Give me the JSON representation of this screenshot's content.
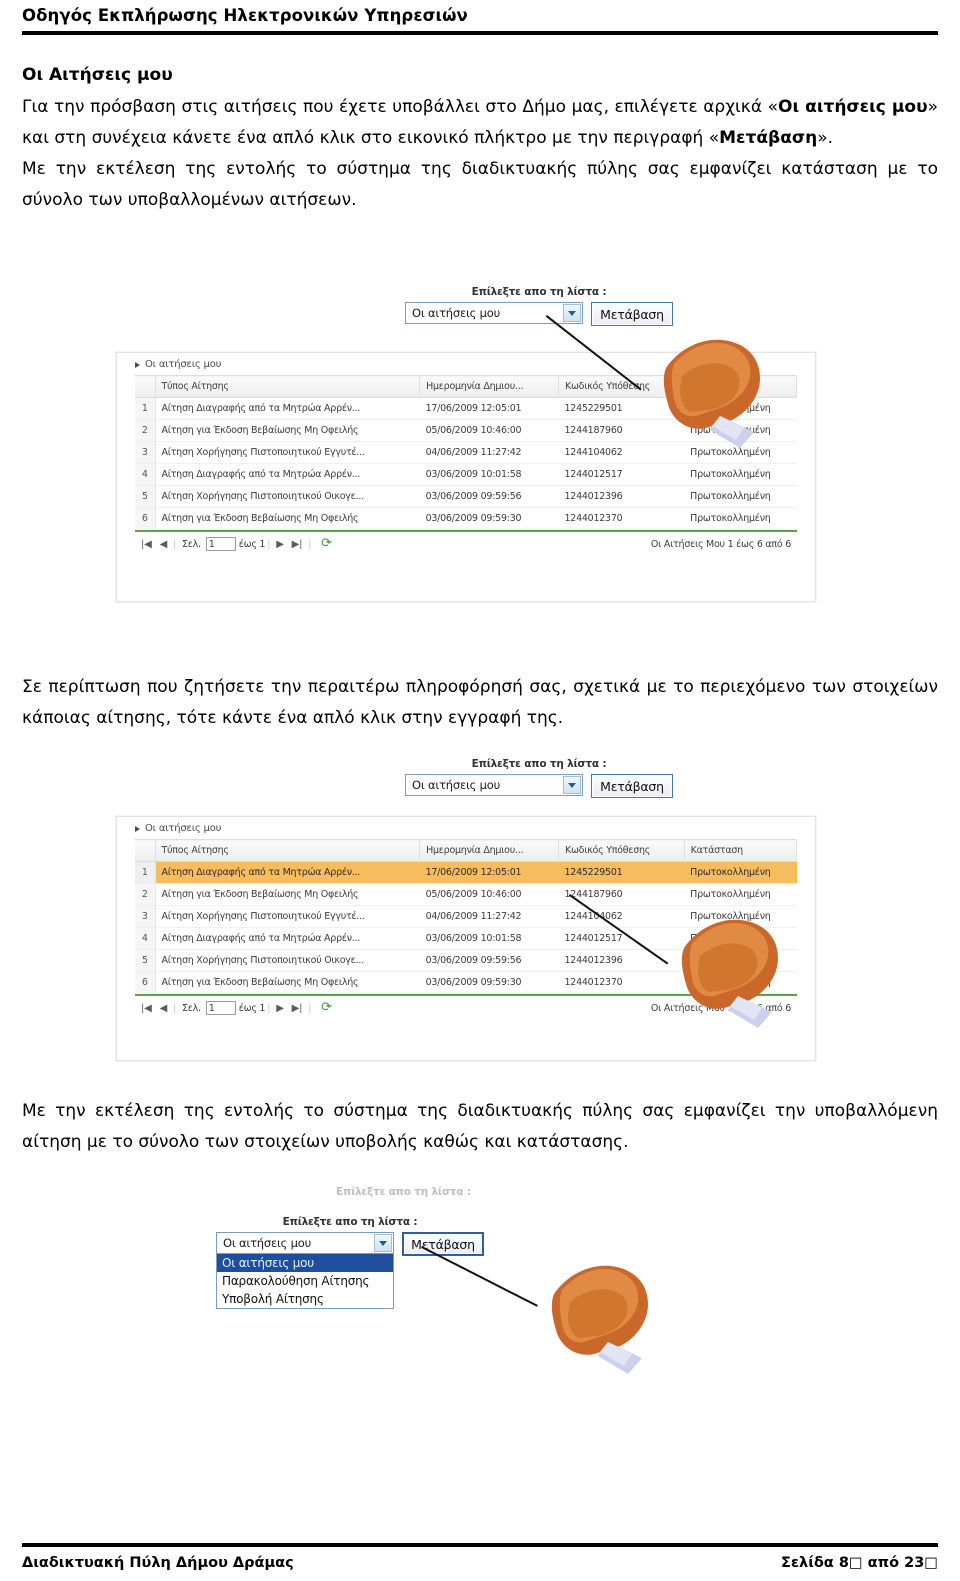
{
  "header": {
    "title": "Οδηγός Εκπλήρωσης Ηλεκτρονικών Υπηρεσιών"
  },
  "section": {
    "title": "Οι Αιτήσεις μου",
    "para1_a": "Για την πρόσβαση στις αιτήσεις που έχετε υποβάλλει στο Δήμο μας, επιλέγετε αρχικά «",
    "para1_b": "Οι αιτήσεις μου",
    "para1_c": "» και στη συνέχεια κάνετε ένα απλό κλικ στο εικονικό πλήκτρο με την περιγραφή «",
    "para1_d": "Μετάβαση",
    "para1_e": "».",
    "para2": "Με την εκτέλεση της εντολής το σύστημα της διαδικτυακής πύλης σας εμφανίζει κατάσταση με το σύνολο των υποβαλλομένων αιτήσεων.",
    "para3": "Σε περίπτωση που ζητήσετε την περαιτέρω πληροφόρησή σας, σχετικά με το περιεχόμενο των στοιχείων κάποιας αίτησης, τότε κάντε ένα απλό κλικ στην εγγραφή της.",
    "para4": "Με την εκτέλεση της εντολής το σύστημα της διαδικτυακής πύλης σας εμφανίζει την υποβαλλόμενη αίτηση με το σύνολο των στοιχείων υποβολής καθώς και κατάστασης."
  },
  "app": {
    "select_label": "Επίλεξτε απο τη λίστα :",
    "selected_value": "Οι αιτήσεις μου",
    "go_button": "Μετάβαση",
    "dropdown_options": [
      "Οι αιτήσεις μου",
      "Παρακολούθηση Αίτησης",
      "Υποβολή Αίτησης"
    ],
    "breadcrumb": "Οι αιτήσεις μου",
    "columns": [
      "",
      "Τύπος Αίτησης",
      "Ημερομηνία Δημιου...",
      "Κωδικός Υπόθεσης",
      "Κατάσταση"
    ],
    "rows": [
      {
        "n": "1",
        "type": "Αίτηση Διαγραφής από τα Μητρώα Αρρέν...",
        "date": "17/06/2009 12:05:01",
        "code": "1245229501",
        "status": "Πρωτοκολλημένη"
      },
      {
        "n": "2",
        "type": "Αίτηση για Έκδοση Βεβαίωσης Μη Οφειλής",
        "date": "05/06/2009 10:46:00",
        "code": "1244187960",
        "status": "Πρωτοκολλημένη"
      },
      {
        "n": "3",
        "type": "Αίτηση Χορήγησης Πιστοποιητικού Εγγυτέ...",
        "date": "04/06/2009 11:27:42",
        "code": "1244104062",
        "status": "Πρωτοκολλημένη"
      },
      {
        "n": "4",
        "type": "Αίτηση Διαγραφής από τα Μητρώα Αρρέν...",
        "date": "03/06/2009 10:01:58",
        "code": "1244012517",
        "status": "Πρωτοκολλημένη"
      },
      {
        "n": "5",
        "type": "Αίτηση Χορήγησης Πιστοποιητικού Οικογε...",
        "date": "03/06/2009 09:59:56",
        "code": "1244012396",
        "status": "Πρωτοκολλημένη"
      },
      {
        "n": "6",
        "type": "Αίτηση για Έκδοση Βεβαίωσης Μη Οφειλής",
        "date": "03/06/2009 09:59:30",
        "code": "1244012370",
        "status": "Πρωτοκολλημένη"
      }
    ],
    "pager": {
      "first": "|◀",
      "prev": "◀",
      "page_word": "Σελ.",
      "page_value": "1",
      "of_word": "έως 1",
      "next": "▶",
      "last": "▶|",
      "refresh": "⟳",
      "summary": "Οι Αιτήσεις Μου 1 έως 6 από 6"
    },
    "highlighted_row_index": 1
  },
  "footer": {
    "left": "Διαδικτυακή Πύλη Δήμου Δράμας",
    "right_a": "Σελίδα 8",
    "right_box1": "□",
    "right_b": " από 23",
    "right_box2": "□"
  },
  "colors": {
    "highlight_row": "#f6bd5f",
    "grid_foot_rule": "#5f9e4d",
    "dropdown_selected": "#1f4f9c",
    "hand_skin": "#c9682a",
    "hand_skin_light": "#e08a44",
    "cuff": "#ccd0ec"
  }
}
